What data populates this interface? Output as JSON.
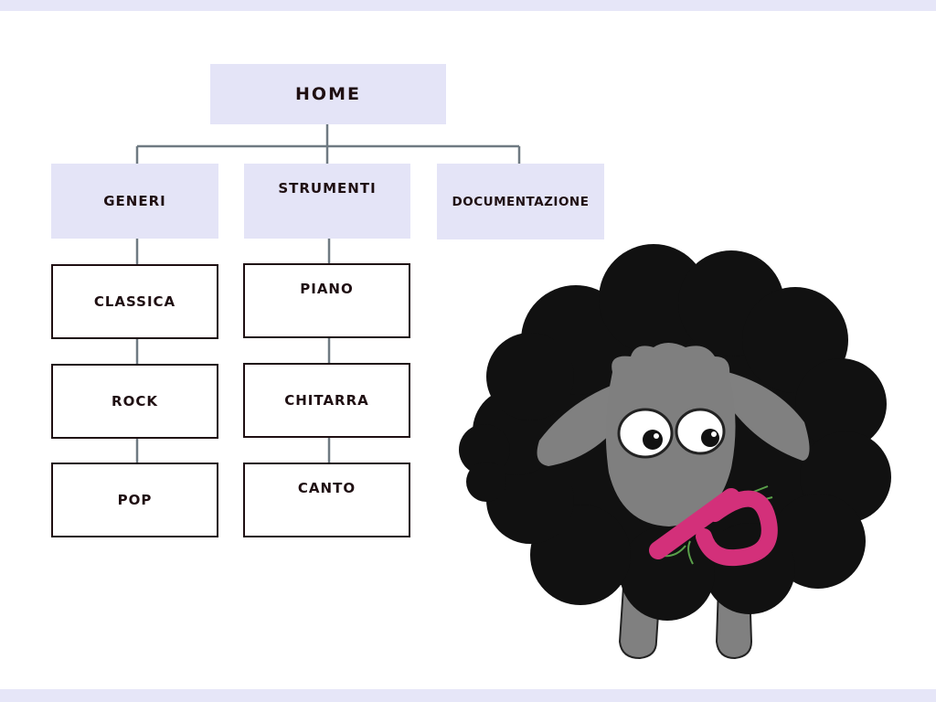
{
  "sitemap": {
    "home": "HOME",
    "categories": [
      {
        "label": "GENERI",
        "children": [
          "CLASSICA",
          "ROCK",
          "POP"
        ]
      },
      {
        "label": "STRUMENTI",
        "children": [
          "PIANO",
          "CHITARRA",
          "CANTO"
        ]
      },
      {
        "label": "DOCUMENTAZIONE",
        "children": []
      }
    ]
  },
  "colors": {
    "band": "#e6e6f8",
    "box_fill": "#e4e4f7",
    "box_border": "#1f0f12",
    "text": "#1f0f12",
    "connector": "#6f7a82",
    "sheep_wool": "#111111",
    "sheep_face": "#808080",
    "logo_pink": "#d3307a"
  },
  "illustration": {
    "icon": "black-sheep-mascot-icon",
    "logo_letter": "P"
  }
}
